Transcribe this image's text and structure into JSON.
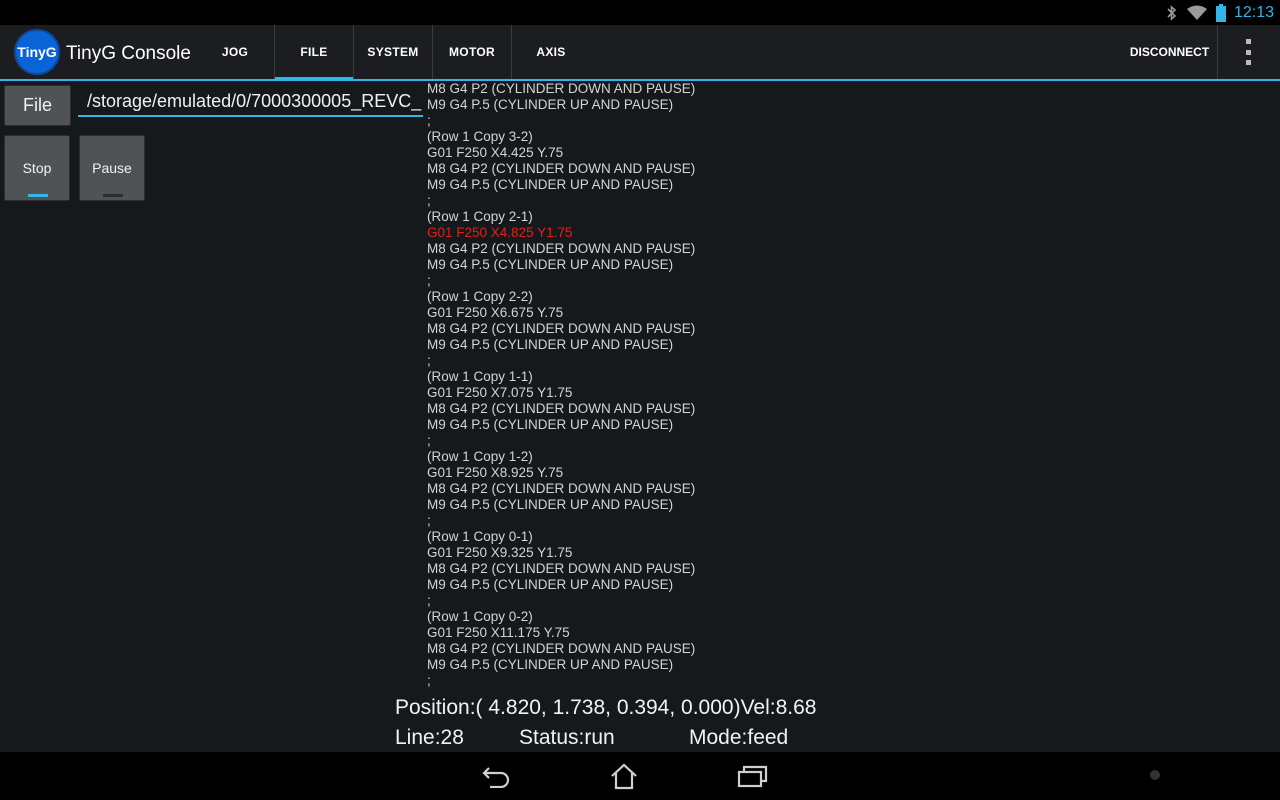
{
  "statusbar": {
    "time": "12:13",
    "icons": [
      "bluetooth-icon",
      "wifi-icon",
      "battery-icon"
    ]
  },
  "actionbar": {
    "app_icon_text": "TinyG",
    "app_title": "TinyG Console",
    "tabs": [
      {
        "label": "JOG",
        "selected": false
      },
      {
        "label": "FILE",
        "selected": true
      },
      {
        "label": "SYSTEM",
        "selected": false
      },
      {
        "label": "MOTOR",
        "selected": false
      },
      {
        "label": "AXIS",
        "selected": false
      }
    ],
    "disconnect_label": "DISCONNECT",
    "overflow_icon": "overflow-menu-icon"
  },
  "controls": {
    "file_button_label": "File",
    "file_path": "/storage/emulated/0/7000300005_REVC_",
    "stop_label": "Stop",
    "stop_on": true,
    "pause_label": "Pause",
    "pause_on": false
  },
  "gcode": {
    "current_index": 9,
    "lines": [
      "M8 G4 P2 (CYLINDER DOWN AND PAUSE)",
      "M9 G4 P.5 (CYLINDER UP AND PAUSE)",
      ";",
      "(Row 1 Copy 3-2)",
      "G01 F250 X4.425 Y.75",
      "M8 G4 P2 (CYLINDER DOWN AND PAUSE)",
      "M9 G4 P.5 (CYLINDER UP AND PAUSE)",
      ";",
      "(Row 1 Copy 2-1)",
      "G01 F250 X4.825 Y1.75",
      "M8 G4 P2 (CYLINDER DOWN AND PAUSE)",
      "M9 G4 P.5 (CYLINDER UP AND PAUSE)",
      ";",
      "(Row 1 Copy 2-2)",
      "G01 F250 X6.675 Y.75",
      "M8 G4 P2 (CYLINDER DOWN AND PAUSE)",
      "M9 G4 P.5 (CYLINDER UP AND PAUSE)",
      ";",
      "(Row 1 Copy 1-1)",
      "G01 F250 X7.075 Y1.75",
      "M8 G4 P2 (CYLINDER DOWN AND PAUSE)",
      "M9 G4 P.5 (CYLINDER UP AND PAUSE)",
      ";",
      "(Row 1 Copy 1-2)",
      "G01 F250 X8.925 Y.75",
      "M8 G4 P2 (CYLINDER DOWN AND PAUSE)",
      "M9 G4 P.5 (CYLINDER UP AND PAUSE)",
      ";",
      "(Row 1 Copy 0-1)",
      "G01 F250 X9.325 Y1.75",
      "M8 G4 P2 (CYLINDER DOWN AND PAUSE)",
      "M9 G4 P.5 (CYLINDER UP AND PAUSE)",
      ";",
      "(Row 1 Copy 0-2)",
      "G01 F250 X11.175 Y.75",
      "M8 G4 P2 (CYLINDER DOWN AND PAUSE)",
      "M9 G4 P.5 (CYLINDER UP AND PAUSE)",
      ";"
    ]
  },
  "status": {
    "position_text": "Position:( 4.820, 1.738, 0.394, 0.000)Vel:8.68",
    "line_text": "Line:28",
    "status_text": "Status:run",
    "mode_text": "Mode:feed"
  },
  "navbar": {
    "icons": [
      "back-icon",
      "home-icon",
      "recent-apps-icon"
    ]
  },
  "colors": {
    "accent": "#33b5e5",
    "current_line": "#e0201a",
    "text": "#d3d3d3"
  }
}
